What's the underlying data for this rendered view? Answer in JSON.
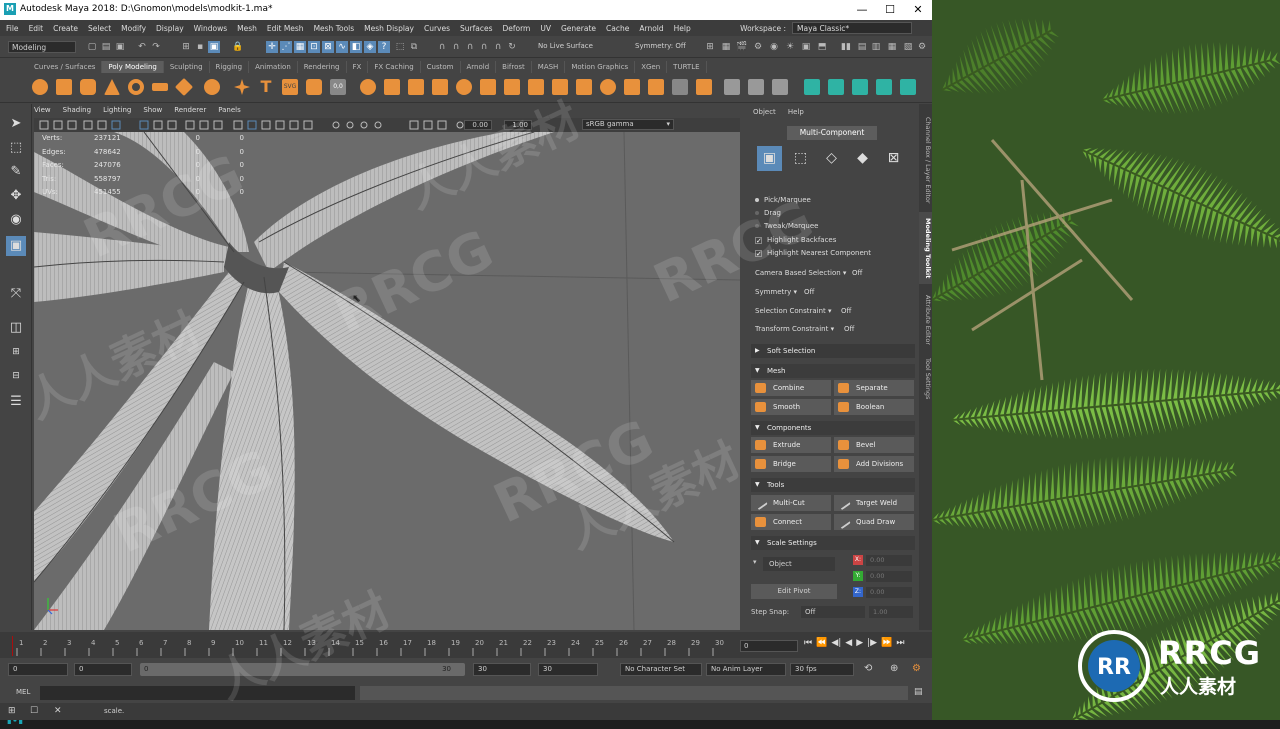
{
  "window": {
    "title": "Autodesk Maya 2018: D:\\Gnomon\\models\\modkit-1.ma*",
    "controls": [
      "—",
      "☐",
      "✕"
    ]
  },
  "menubar": {
    "items": [
      "File",
      "Edit",
      "Create",
      "Select",
      "Modify",
      "Display",
      "Windows",
      "Mesh",
      "Edit Mesh",
      "Mesh Tools",
      "Mesh Display",
      "Curves",
      "Surfaces",
      "Deform",
      "UV",
      "Generate",
      "Cache",
      "Arnold",
      "Help"
    ],
    "workspace_label": "Workspace :",
    "workspace_value": "Maya Classic*"
  },
  "statusline": {
    "mode": "Modeling",
    "live_surface": "No Live Surface",
    "symmetry": "Symmetry: Off"
  },
  "shelf": {
    "tabs": [
      "Curves / Surfaces",
      "Poly Modeling",
      "Sculpting",
      "Rigging",
      "Animation",
      "Rendering",
      "FX",
      "FX Caching",
      "Custom",
      "Arnold",
      "Bifrost",
      "MASH",
      "Motion Graphics",
      "XGen",
      "TURTLE"
    ],
    "active_tab": "Poly Modeling"
  },
  "panel": {
    "menu": [
      "View",
      "Shading",
      "Lighting",
      "Show",
      "Renderer",
      "Panels"
    ],
    "near_value": "0.00",
    "far_value": "1.00",
    "color_space": "sRGB gamma"
  },
  "hud": {
    "rows": [
      {
        "label": "Verts:",
        "v1": "237121",
        "v2": "0",
        "v3": "0"
      },
      {
        "label": "Edges:",
        "v1": "478642",
        "v2": "0",
        "v3": "0"
      },
      {
        "label": "Faces:",
        "v1": "247076",
        "v2": "0",
        "v3": "0"
      },
      {
        "label": "Tris:",
        "v1": "558797",
        "v2": "0",
        "v3": "0"
      },
      {
        "label": "UVs:",
        "v1": "451455",
        "v2": "0",
        "v3": "0"
      }
    ]
  },
  "modeling_toolkit": {
    "menu": [
      "Object",
      "Help"
    ],
    "multi_component": "Multi-Component",
    "selection_modes": [
      {
        "name": "Pick/Marquee",
        "active": true
      },
      {
        "name": "Drag",
        "active": false
      },
      {
        "name": "Tweak/Marquee",
        "active": false
      }
    ],
    "checks": [
      "Highlight Backfaces",
      "Highlight Nearest Component"
    ],
    "camera_based_selection": {
      "label": "Camera Based Selection",
      "value": "Off"
    },
    "symmetry": {
      "label": "Symmetry",
      "value": "Off"
    },
    "selection_constraint": {
      "label": "Selection Constraint",
      "value": "Off"
    },
    "transform_constraint": {
      "label": "Transform Constraint",
      "value": "Off"
    },
    "soft_selection": "Soft Selection",
    "mesh_section": "Mesh",
    "mesh_buttons": [
      "Combine",
      "Separate",
      "Smooth",
      "Boolean"
    ],
    "components_section": "Components",
    "component_buttons": [
      "Extrude",
      "Bevel",
      "Bridge",
      "Add Divisions"
    ],
    "tools_section": "Tools",
    "tool_buttons": [
      "Multi-Cut",
      "Target Weld",
      "Connect",
      "Quad Draw"
    ],
    "scale_section": "Scale Settings",
    "scale_space": "Object",
    "axes": [
      "X:",
      "Y:",
      "Z:"
    ],
    "axis_values": [
      "0.00",
      "0.00",
      "0.00"
    ],
    "edit_pivot": "Edit Pivot",
    "step_snap_label": "Step Snap:",
    "step_snap_value": "Off",
    "step_snap_num": "1.00"
  },
  "vertical_tabs": [
    "Channel Box / Layer Editor",
    "Modeling Toolkit",
    "Attribute Editor",
    "Tool Settings"
  ],
  "timeslider": {
    "ticks": [
      "1",
      "2",
      "3",
      "4",
      "5",
      "6",
      "7",
      "8",
      "9",
      "10",
      "11",
      "12",
      "13",
      "14",
      "15",
      "16",
      "17",
      "18",
      "19",
      "20",
      "21",
      "22",
      "23",
      "24",
      "25",
      "26",
      "27",
      "28",
      "29",
      "30"
    ],
    "current_frame": "0"
  },
  "rangebar": {
    "start": "0",
    "anim_start": "0",
    "slider_start": "0",
    "slider_end": "30",
    "anim_end": "30",
    "end": "30",
    "character_set": "No Character Set",
    "anim_layer": "No Anim Layer",
    "fps": "30 fps"
  },
  "cmdline": {
    "label": "MEL"
  },
  "helpline": {
    "text": "scale."
  },
  "watermarks": [
    "RRCG",
    "人人素材"
  ],
  "brand": {
    "name": "RRCG",
    "sub": "人人素材"
  },
  "colors": {
    "accent": "#5b8ab8",
    "orange": "#e8913c",
    "maya_teal": "#1aa6b7"
  }
}
